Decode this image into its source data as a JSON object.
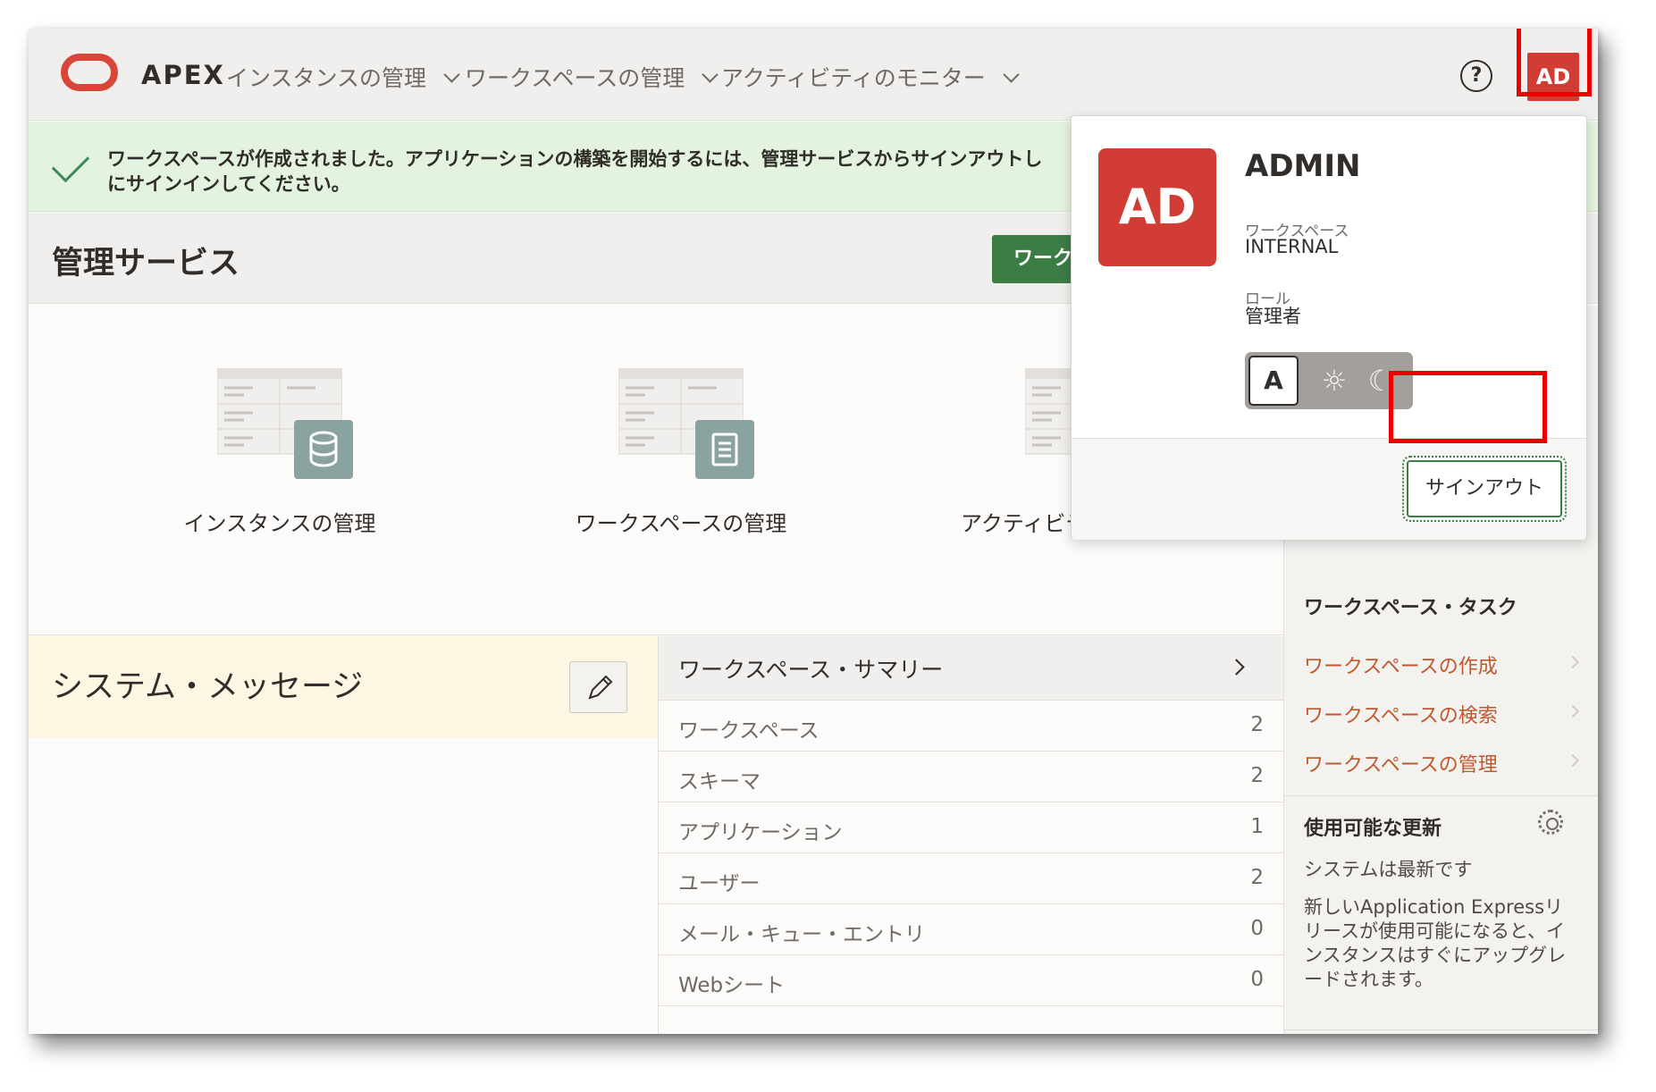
{
  "header": {
    "brand": "APEX",
    "nav": [
      {
        "label": "インスタンスの管理"
      },
      {
        "label": "ワークスペースの管理"
      },
      {
        "label": "アクティビティのモニター"
      }
    ],
    "help_glyph": "?",
    "avatar_initials": "AD"
  },
  "alert": {
    "message": "ワークスペースが作成されました。アプリケーションの構築を開始するには、管理サービスからサインアウトしにサインインしてください。",
    "line1": "ワークスペースが作成されました。アプリケーションの構築を開始するには、管理サービスからサインアウトし",
    "line2": "にサインインしてください。"
  },
  "page": {
    "title": "管理サービス",
    "primary_button": "ワーク"
  },
  "cards": [
    {
      "label": "インスタンスの管理"
    },
    {
      "label": "ワークスペースの管理"
    },
    {
      "label": "アクティビティのモニター"
    }
  ],
  "system_message": {
    "title": "システム・メッセージ"
  },
  "summary": {
    "title": "ワークスペース・サマリー",
    "rows": [
      {
        "label": "ワークスペース",
        "value": "2"
      },
      {
        "label": "スキーマ",
        "value": "2"
      },
      {
        "label": "アプリケーション",
        "value": "1"
      },
      {
        "label": "ユーザー",
        "value": "2"
      },
      {
        "label": "メール・キュー・エントリ",
        "value": "0"
      },
      {
        "label": "Webシート",
        "value": "0"
      }
    ]
  },
  "sidebar": {
    "tasks_title": "ワークスペース・タスク",
    "links": [
      {
        "label": "ワークスペースの作成"
      },
      {
        "label": "ワークスペースの検索"
      },
      {
        "label": "ワークスペースの管理"
      }
    ],
    "updates_title": "使用可能な更新",
    "status": "システムは最新です",
    "note": "新しいApplication Expressリリースが使用可能になると、インスタンスはすぐにアップグレードされます。"
  },
  "user_menu": {
    "initials": "AD",
    "name": "ADMIN",
    "workspace_label": "ワークスペース",
    "workspace": "INTERNAL",
    "role_label": "ロール",
    "role": "管理者",
    "theme_auto_glyph": "A",
    "theme_light_glyph": "☼",
    "theme_dark_glyph": "☾",
    "sign_out": "サインアウト"
  },
  "colors": {
    "brand_red": "#d13d35",
    "success_green": "#3c7d45",
    "link_orange": "#c0582e",
    "highlight_red": "#ee0000"
  }
}
